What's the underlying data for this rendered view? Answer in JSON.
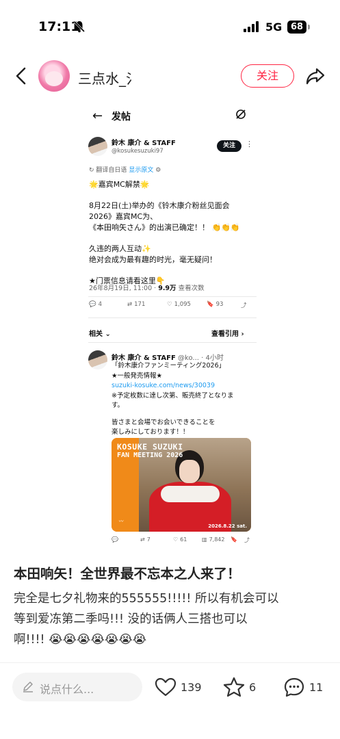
{
  "status_bar": {
    "time": "17:11",
    "network": "5G",
    "battery": "68"
  },
  "header": {
    "username": "三点水_氵",
    "follow_label": "关注"
  },
  "tweet": {
    "header_title": "发帖",
    "author_name": "鈴木 康介 & STAFF",
    "author_handle": "@kosukesuzuki97",
    "follow_label": "关注",
    "translated_from": "翻译自日语",
    "show_original": "显示原文",
    "lines": [
      "🌟嘉宾MC解禁🌟",
      "",
      "8月22日(土)举办的《铃木康介粉丝见面会",
      "2026》嘉宾MC为、",
      "《本田响矢さん》的出演已确定！！ 👏👏👏",
      "",
      "久违的两人互动✨",
      "绝对会成为最有趣的时光，毫无疑问！",
      "",
      "★门票信息请看这里👇"
    ],
    "meta_time": "26年8月19日, 11:00 · ",
    "meta_views": "9.9万",
    "meta_views_label": " 查看次数",
    "actions": {
      "replies": "4",
      "retweets": "171",
      "likes": "1,095",
      "bookmarks": "93"
    },
    "related_label": "相关",
    "quotes_label": "查看引用",
    "quoted": {
      "author_name": "鈴木 康介 & STAFF",
      "handle_time": "@ko... · 4小时",
      "lines": [
        "「鈴木康介ファンミーティング2026」",
        "★一般発売情報★",
        "suzuki-kosuke.com/news/30039",
        "※予定枚数に達し次第、販売終了となりま",
        "す。",
        "",
        "皆さまと会場でお会いできることを",
        "楽しみにしております！！"
      ],
      "poster_title": "KOSUKE SUZUKI",
      "poster_subtitle": "FAN MEETING 2026",
      "poster_date": "2026.8.22 sat.",
      "actions": {
        "retweets": "7",
        "likes": "61",
        "views": "7,842"
      }
    }
  },
  "post": {
    "title": "本田响矢！全世界最不忘本之人来了！",
    "body_lines": [
      "完全是七夕礼物来的555555!!!!! 所以有机会可以",
      "等到爱冻第二季吗!!! 没的话俩人三搭也可以",
      "啊!!!! 😭😭😭😭😭😭😭"
    ]
  },
  "bottom_bar": {
    "comment_placeholder": "说点什么...",
    "likes": "139",
    "stars": "6",
    "comments": "11"
  },
  "colors": {
    "accent": "#ff2442",
    "link": "#1d9bf0",
    "poster": "#f28a1a"
  }
}
